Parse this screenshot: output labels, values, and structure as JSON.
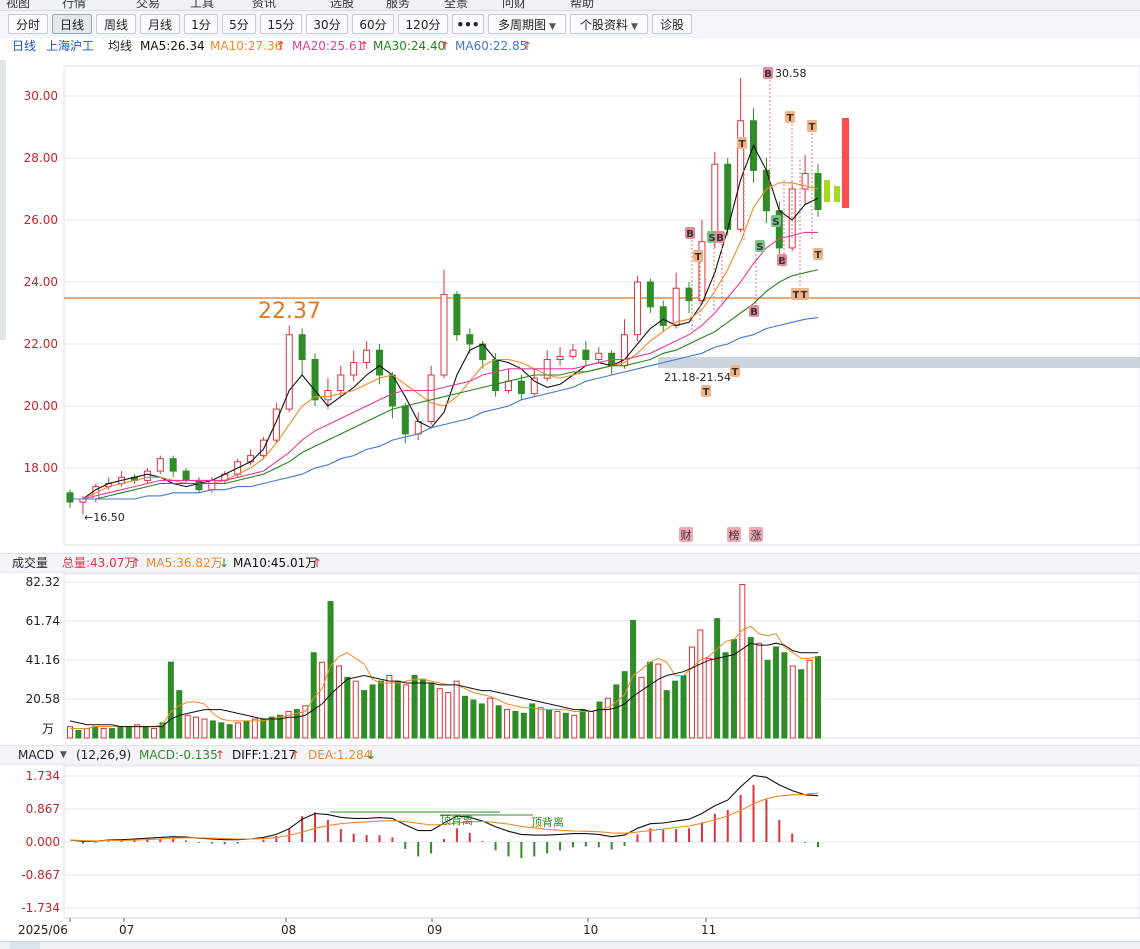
{
  "menu": [
    "视图",
    "行情",
    "交易",
    "工具",
    "资讯",
    "选股",
    "服务",
    "全景",
    "问财",
    "帮助"
  ],
  "toolbar": {
    "buttons": [
      "分时",
      "日线",
      "周线",
      "月线",
      "1分",
      "5分",
      "15分",
      "30分",
      "60分",
      "120分"
    ],
    "more": "•••",
    "multi_period": "多周期图",
    "stock_info": "个股资料",
    "diagnose": "诊股",
    "active": "日线"
  },
  "legend": {
    "period": "日线",
    "exchange": "上海沪工",
    "avg_line": "均线",
    "ma5": "MA5:26.34",
    "ma10": "MA10:27.36",
    "ma20": "MA20:25.61",
    "ma30": "MA30:24.40",
    "ma60": "MA60:22.85",
    "up_arrow": "↑",
    "down_arrow": "↓"
  },
  "volume_legend": {
    "title": "成交量",
    "total": "总量:43.07万",
    "ma5": "MA5:36.82万",
    "ma10": "MA10:45.01万",
    "unit": "万"
  },
  "macd_legend": {
    "title": "MACD",
    "params": "(12,26,9)",
    "macd": "MACD:-0.135",
    "diff": "DIFF:1.217",
    "dea": "DEA:1.284"
  },
  "colors": {
    "up": "#e0313a",
    "down": "#2f8c26",
    "ma5": "#111111",
    "ma10": "#f08a24",
    "ma20": "#e83a9c",
    "ma30": "#27861d",
    "ma60": "#3f78d6",
    "level": "#e0781e"
  },
  "chart_data": [
    {
      "type": "line",
      "subtype": "candlestick",
      "y_ticks": [
        "30.00",
        "28.00",
        "26.00",
        "24.00",
        "22.00",
        "20.00",
        "18.00"
      ],
      "ylim": [
        16.0,
        31.0
      ],
      "x_labels": [
        "2025/06",
        "07",
        "08",
        "09",
        "10",
        "11"
      ],
      "annotations": {
        "low": "←16.50",
        "high": "30.58",
        "level": "22.37",
        "range": "21.18-21.54",
        "event_tags": [
          "财",
          "榜",
          "涨"
        ],
        "signal_letters": [
          "B",
          "T",
          "S"
        ]
      },
      "series": [
        {
          "name": "MA5",
          "values": [
            17.0,
            17.0,
            17.3,
            17.5,
            17.6,
            17.7,
            17.8,
            17.7,
            17.5,
            17.4,
            17.5,
            17.6,
            17.8,
            18.0,
            18.2,
            18.6,
            19.5,
            20.5,
            21.0,
            20.5,
            20.0,
            20.3,
            20.6,
            21.0,
            21.3,
            21.0,
            20.3,
            19.5,
            19.3,
            19.8,
            21.0,
            21.8,
            22.0,
            21.5,
            21.4,
            21.2,
            20.8,
            20.6,
            20.7,
            21.0,
            21.3,
            21.4,
            21.3,
            21.5,
            22.0,
            22.5,
            22.8,
            22.6,
            22.7,
            23.3,
            24.3,
            25.7,
            27.3,
            28.4,
            27.6,
            26.3,
            26.0,
            26.5,
            26.7
          ]
        },
        {
          "name": "MA10",
          "values": [
            17.0,
            17.0,
            17.2,
            17.4,
            17.5,
            17.6,
            17.7,
            17.7,
            17.6,
            17.5,
            17.5,
            17.5,
            17.6,
            17.8,
            18.0,
            18.3,
            18.8,
            19.4,
            20.0,
            20.3,
            20.3,
            20.4,
            20.5,
            20.7,
            20.9,
            21.0,
            20.7,
            20.4,
            20.1,
            20.0,
            20.3,
            20.8,
            21.3,
            21.5,
            21.5,
            21.4,
            21.2,
            21.0,
            20.9,
            21.0,
            21.1,
            21.2,
            21.3,
            21.4,
            21.7,
            22.1,
            22.4,
            22.7,
            22.8,
            23.1,
            23.7,
            24.4,
            25.3,
            26.4,
            27.0,
            27.2,
            27.2,
            27.1,
            27.0
          ]
        },
        {
          "name": "MA20",
          "values": [
            17.0,
            17.0,
            17.1,
            17.2,
            17.3,
            17.4,
            17.5,
            17.6,
            17.6,
            17.6,
            17.6,
            17.6,
            17.6,
            17.7,
            17.8,
            17.9,
            18.2,
            18.5,
            18.9,
            19.2,
            19.4,
            19.6,
            19.8,
            20.0,
            20.2,
            20.4,
            20.5,
            20.5,
            20.5,
            20.6,
            20.7,
            20.8,
            21.0,
            21.1,
            21.2,
            21.2,
            21.2,
            21.2,
            21.2,
            21.2,
            21.3,
            21.4,
            21.5,
            21.5,
            21.6,
            21.7,
            21.9,
            22.1,
            22.3,
            22.6,
            23.0,
            23.5,
            24.0,
            24.6,
            25.1,
            25.4,
            25.5,
            25.6,
            25.6
          ]
        },
        {
          "name": "MA30",
          "values": [
            17.0,
            17.0,
            17.0,
            17.1,
            17.2,
            17.3,
            17.4,
            17.5,
            17.5,
            17.5,
            17.5,
            17.5,
            17.5,
            17.6,
            17.7,
            17.8,
            18.0,
            18.2,
            18.5,
            18.7,
            18.9,
            19.1,
            19.3,
            19.5,
            19.7,
            19.9,
            20.0,
            20.1,
            20.2,
            20.3,
            20.4,
            20.5,
            20.6,
            20.7,
            20.8,
            20.9,
            21.0,
            21.0,
            21.0,
            21.1,
            21.1,
            21.2,
            21.3,
            21.3,
            21.4,
            21.5,
            21.7,
            21.8,
            22.0,
            22.2,
            22.4,
            22.7,
            23.0,
            23.3,
            23.7,
            24.0,
            24.2,
            24.3,
            24.4
          ]
        },
        {
          "name": "MA60",
          "values": [
            17.0,
            17.0,
            17.0,
            17.0,
            17.0,
            17.0,
            17.1,
            17.1,
            17.2,
            17.2,
            17.2,
            17.3,
            17.3,
            17.4,
            17.4,
            17.5,
            17.6,
            17.7,
            17.8,
            18.0,
            18.1,
            18.3,
            18.4,
            18.6,
            18.7,
            18.9,
            19.0,
            19.1,
            19.3,
            19.4,
            19.5,
            19.6,
            19.8,
            19.9,
            20.0,
            20.2,
            20.3,
            20.4,
            20.5,
            20.6,
            20.8,
            20.9,
            21.0,
            21.1,
            21.2,
            21.3,
            21.4,
            21.5,
            21.6,
            21.7,
            21.9,
            22.0,
            22.2,
            22.3,
            22.5,
            22.6,
            22.7,
            22.8,
            22.85
          ]
        }
      ],
      "candles": [
        [
          17.2,
          16.9,
          17.3,
          16.7
        ],
        [
          16.9,
          17.0,
          17.1,
          16.5
        ],
        [
          17.0,
          17.4,
          17.5,
          16.9
        ],
        [
          17.4,
          17.5,
          17.7,
          17.3
        ],
        [
          17.5,
          17.7,
          17.9,
          17.4
        ],
        [
          17.7,
          17.6,
          17.8,
          17.5
        ],
        [
          17.6,
          17.9,
          18.0,
          17.5
        ],
        [
          17.9,
          18.3,
          18.4,
          17.8
        ],
        [
          18.3,
          17.9,
          18.4,
          17.7
        ],
        [
          17.9,
          17.6,
          18.0,
          17.5
        ],
        [
          17.6,
          17.3,
          17.7,
          17.2
        ],
        [
          17.3,
          17.6,
          17.7,
          17.2
        ],
        [
          17.6,
          17.8,
          17.9,
          17.5
        ],
        [
          17.8,
          18.2,
          18.3,
          17.7
        ],
        [
          18.2,
          18.4,
          18.6,
          18.1
        ],
        [
          18.4,
          18.9,
          19.0,
          18.3
        ],
        [
          18.9,
          19.9,
          20.1,
          18.8
        ],
        [
          19.9,
          22.3,
          22.6,
          19.8
        ],
        [
          22.3,
          21.5,
          22.5,
          21.0
        ],
        [
          21.5,
          20.2,
          21.7,
          20.0
        ],
        [
          20.2,
          20.5,
          20.9,
          19.9
        ],
        [
          20.5,
          21.0,
          21.3,
          20.3
        ],
        [
          21.0,
          21.4,
          21.8,
          20.8
        ],
        [
          21.4,
          21.8,
          22.1,
          21.2
        ],
        [
          21.8,
          21.0,
          22.0,
          20.7
        ],
        [
          21.0,
          20.0,
          21.1,
          19.6
        ],
        [
          20.0,
          19.1,
          20.1,
          18.8
        ],
        [
          19.1,
          19.5,
          19.8,
          18.9
        ],
        [
          19.5,
          21.0,
          21.3,
          19.4
        ],
        [
          21.0,
          23.6,
          24.4,
          20.9
        ],
        [
          23.6,
          22.3,
          23.7,
          22.1
        ],
        [
          22.3,
          22.0,
          22.5,
          21.7
        ],
        [
          22.0,
          21.5,
          22.1,
          21.2
        ],
        [
          21.5,
          20.5,
          21.7,
          20.3
        ],
        [
          20.5,
          20.8,
          21.2,
          20.4
        ],
        [
          20.8,
          20.4,
          21.0,
          20.2
        ],
        [
          20.4,
          20.9,
          21.2,
          20.3
        ],
        [
          20.9,
          21.5,
          21.8,
          20.8
        ],
        [
          21.5,
          21.6,
          21.9,
          21.3
        ],
        [
          21.6,
          21.8,
          22.0,
          21.5
        ],
        [
          21.8,
          21.5,
          22.1,
          21.3
        ],
        [
          21.5,
          21.7,
          21.9,
          21.4
        ],
        [
          21.7,
          21.3,
          21.8,
          21.0
        ],
        [
          21.3,
          22.3,
          22.8,
          21.2
        ],
        [
          22.3,
          24.0,
          24.2,
          22.1
        ],
        [
          24.0,
          23.2,
          24.1,
          23.0
        ],
        [
          23.2,
          22.6,
          23.4,
          22.4
        ],
        [
          22.6,
          23.8,
          24.3,
          22.5
        ],
        [
          23.8,
          23.4,
          24.0,
          23.0
        ],
        [
          23.4,
          25.3,
          26.0,
          23.3
        ],
        [
          25.3,
          27.8,
          28.2,
          25.1
        ],
        [
          27.8,
          25.7,
          28.0,
          25.5
        ],
        [
          25.7,
          29.2,
          30.58,
          25.6
        ],
        [
          29.2,
          27.6,
          29.6,
          27.2
        ],
        [
          27.6,
          26.3,
          28.0,
          25.9
        ],
        [
          26.3,
          25.1,
          26.6,
          24.8
        ],
        [
          25.1,
          27.0,
          27.2,
          25.0
        ],
        [
          27.0,
          27.5,
          28.1,
          26.5
        ],
        [
          27.5,
          26.34,
          27.8,
          26.1
        ]
      ]
    },
    {
      "type": "bar",
      "y_ticks": [
        "82.32",
        "61.74",
        "41.16",
        "20.58"
      ],
      "ylim": [
        0,
        85
      ],
      "values": [
        6,
        4,
        5,
        6,
        5,
        5,
        6,
        6,
        7,
        6,
        5,
        8,
        40,
        25,
        12,
        11,
        10,
        9,
        8,
        7,
        8,
        9,
        10,
        10,
        11,
        12,
        14,
        15,
        17,
        45,
        40,
        72,
        38,
        32,
        30,
        25,
        28,
        30,
        33,
        30,
        28,
        33,
        31,
        29,
        26,
        24,
        30,
        22,
        20,
        18,
        21,
        17,
        15,
        14,
        13,
        18,
        16,
        15,
        14,
        13,
        12,
        15,
        14,
        19,
        21,
        28,
        35,
        62,
        32,
        40,
        39,
        25,
        30,
        33,
        48,
        57,
        42,
        63,
        45,
        52,
        81,
        53,
        50,
        41,
        48,
        45,
        38,
        36,
        41,
        43
      ],
      "ma5": [
        5,
        5,
        5,
        6,
        6,
        6,
        6,
        6,
        6,
        6,
        6,
        7,
        14,
        17,
        19,
        19,
        18,
        13,
        10,
        9,
        9,
        9,
        9,
        9,
        10,
        11,
        12,
        13,
        14,
        21,
        26,
        38,
        43,
        45,
        42,
        39,
        31,
        29,
        29,
        29,
        30,
        31,
        31,
        30,
        29,
        28,
        28,
        26,
        24,
        23,
        22,
        20,
        18,
        17,
        16,
        16,
        15,
        15,
        15,
        15,
        14,
        14,
        14,
        15,
        16,
        19,
        23,
        33,
        36,
        40,
        42,
        40,
        33,
        33,
        37,
        41,
        43,
        47,
        51,
        52,
        57,
        59,
        55,
        54,
        55,
        48,
        45,
        42,
        42,
        43
      ],
      "ma10": [
        9,
        8,
        7,
        7,
        7,
        7,
        6,
        6,
        6,
        6,
        6,
        6,
        10,
        12,
        13,
        14,
        15,
        15,
        15,
        14,
        13,
        12,
        11,
        10,
        10,
        10,
        11,
        11,
        12,
        15,
        18,
        23,
        27,
        31,
        32,
        33,
        32,
        31,
        30,
        30,
        29,
        29,
        29,
        29,
        28,
        28,
        28,
        27,
        26,
        25,
        25,
        24,
        23,
        22,
        21,
        20,
        19,
        18,
        17,
        16,
        15,
        15,
        14,
        15,
        15,
        16,
        18,
        22,
        25,
        28,
        31,
        33,
        34,
        35,
        37,
        39,
        41,
        42,
        43,
        44,
        47,
        50,
        49,
        49,
        50,
        49,
        46,
        45,
        45,
        45
      ]
    },
    {
      "type": "bar",
      "y_ticks": [
        "1.734",
        "0.867",
        "0.000",
        "-0.867",
        "-1.734"
      ],
      "ylim": [
        -1.734,
        1.734
      ],
      "x_labels": [
        "2025/06",
        "07",
        "08",
        "09",
        "10",
        "11"
      ],
      "annotations": [
        "顶背离",
        "顶背离"
      ],
      "diff": [
        0.05,
        0.02,
        0.02,
        0.05,
        0.06,
        0.08,
        0.1,
        0.12,
        0.14,
        0.13,
        0.1,
        0.08,
        0.06,
        0.06,
        0.08,
        0.12,
        0.2,
        0.35,
        0.6,
        0.75,
        0.72,
        0.65,
        0.62,
        0.62,
        0.64,
        0.62,
        0.45,
        0.3,
        0.3,
        0.5,
        0.68,
        0.65,
        0.55,
        0.4,
        0.28,
        0.2,
        0.18,
        0.18,
        0.2,
        0.22,
        0.22,
        0.2,
        0.14,
        0.18,
        0.36,
        0.48,
        0.5,
        0.55,
        0.6,
        0.75,
        0.95,
        1.1,
        1.45,
        1.75,
        1.7,
        1.5,
        1.35,
        1.24,
        1.217
      ],
      "dea": [
        0.05,
        0.04,
        0.03,
        0.04,
        0.04,
        0.05,
        0.06,
        0.08,
        0.1,
        0.11,
        0.11,
        0.1,
        0.09,
        0.08,
        0.08,
        0.09,
        0.12,
        0.17,
        0.26,
        0.36,
        0.43,
        0.48,
        0.51,
        0.53,
        0.55,
        0.56,
        0.54,
        0.49,
        0.45,
        0.46,
        0.5,
        0.53,
        0.54,
        0.51,
        0.47,
        0.41,
        0.37,
        0.33,
        0.31,
        0.29,
        0.28,
        0.27,
        0.24,
        0.23,
        0.26,
        0.3,
        0.34,
        0.38,
        0.42,
        0.49,
        0.58,
        0.68,
        0.83,
        1.0,
        1.14,
        1.21,
        1.24,
        1.25,
        1.284
      ],
      "macd": [
        0.0,
        -0.04,
        -0.02,
        0.02,
        0.04,
        0.06,
        0.08,
        0.08,
        0.08,
        0.04,
        -0.02,
        -0.04,
        -0.06,
        -0.04,
        0.0,
        0.06,
        0.16,
        0.36,
        0.68,
        0.78,
        0.58,
        0.34,
        0.22,
        0.18,
        0.18,
        0.12,
        -0.18,
        -0.38,
        -0.3,
        0.08,
        0.36,
        0.24,
        0.02,
        -0.22,
        -0.38,
        -0.42,
        -0.38,
        -0.3,
        -0.22,
        -0.14,
        -0.12,
        -0.14,
        -0.2,
        -0.1,
        0.2,
        0.36,
        0.32,
        0.34,
        0.36,
        0.52,
        0.74,
        0.84,
        1.24,
        1.5,
        1.12,
        0.58,
        0.22,
        -0.02,
        -0.135
      ]
    }
  ]
}
